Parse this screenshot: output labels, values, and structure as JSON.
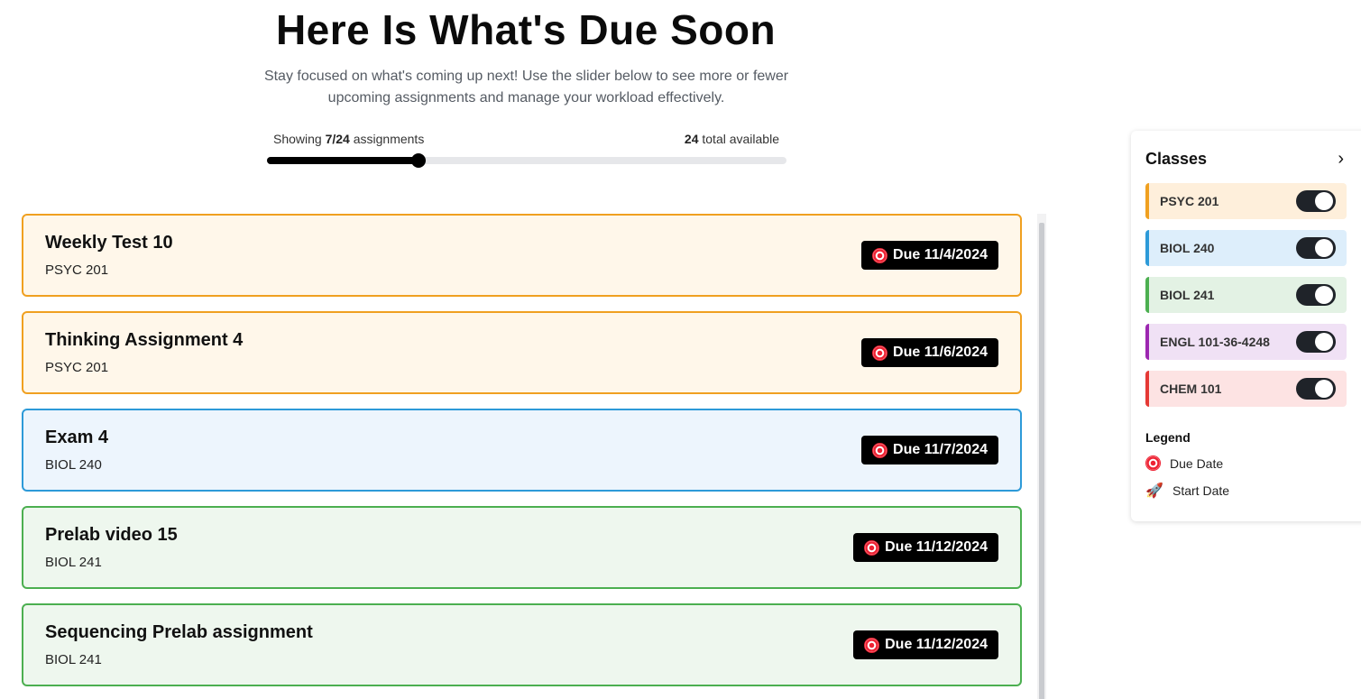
{
  "header": {
    "title": "Here Is What's Due Soon",
    "subtitle": "Stay focused on what's coming up next! Use the slider below to see more or fewer upcoming assignments and manage your workload effectively."
  },
  "slider": {
    "showing_prefix": "Showing ",
    "showing_count": "7/24",
    "showing_suffix": " assignments",
    "total_count": "24",
    "total_suffix": " total available",
    "value": 7,
    "max": 24
  },
  "assignments": [
    {
      "title": "Weekly Test 10",
      "class": "PSYC 201",
      "due": "Due 11/4/2024",
      "border": "#f0a020",
      "bg": "#fff7ea"
    },
    {
      "title": "Thinking Assignment 4",
      "class": "PSYC 201",
      "due": "Due 11/6/2024",
      "border": "#f0a020",
      "bg": "#fff7ea"
    },
    {
      "title": "Exam 4",
      "class": "BIOL 240",
      "due": "Due 11/7/2024",
      "border": "#2d9ad8",
      "bg": "#edf5fd"
    },
    {
      "title": "Prelab video 15",
      "class": "BIOL 241",
      "due": "Due 11/12/2024",
      "border": "#4caf50",
      "bg": "#eef7ee"
    },
    {
      "title": "Sequencing Prelab assignment",
      "class": "BIOL 241",
      "due": "Due 11/12/2024",
      "border": "#4caf50",
      "bg": "#eef7ee"
    }
  ],
  "panel": {
    "title": "Classes",
    "classes": [
      {
        "name": "PSYC 201",
        "color": "#f0a020",
        "bg": "#feefdb",
        "enabled": true
      },
      {
        "name": "BIOL 240",
        "color": "#2d9ad8",
        "bg": "#ddeefb",
        "enabled": true
      },
      {
        "name": "BIOL 241",
        "color": "#4caf50",
        "bg": "#e3f2e4",
        "enabled": true
      },
      {
        "name": "ENGL 101-36-4248",
        "color": "#9c27b0",
        "bg": "#f0e1f5",
        "enabled": true
      },
      {
        "name": "CHEM 101",
        "color": "#e53935",
        "bg": "#fde3e3",
        "enabled": true
      }
    ],
    "legend_title": "Legend",
    "legend": [
      {
        "label": "Due Date",
        "icon": "target-icon"
      },
      {
        "label": "Start Date",
        "icon": "rocket-icon"
      }
    ]
  }
}
